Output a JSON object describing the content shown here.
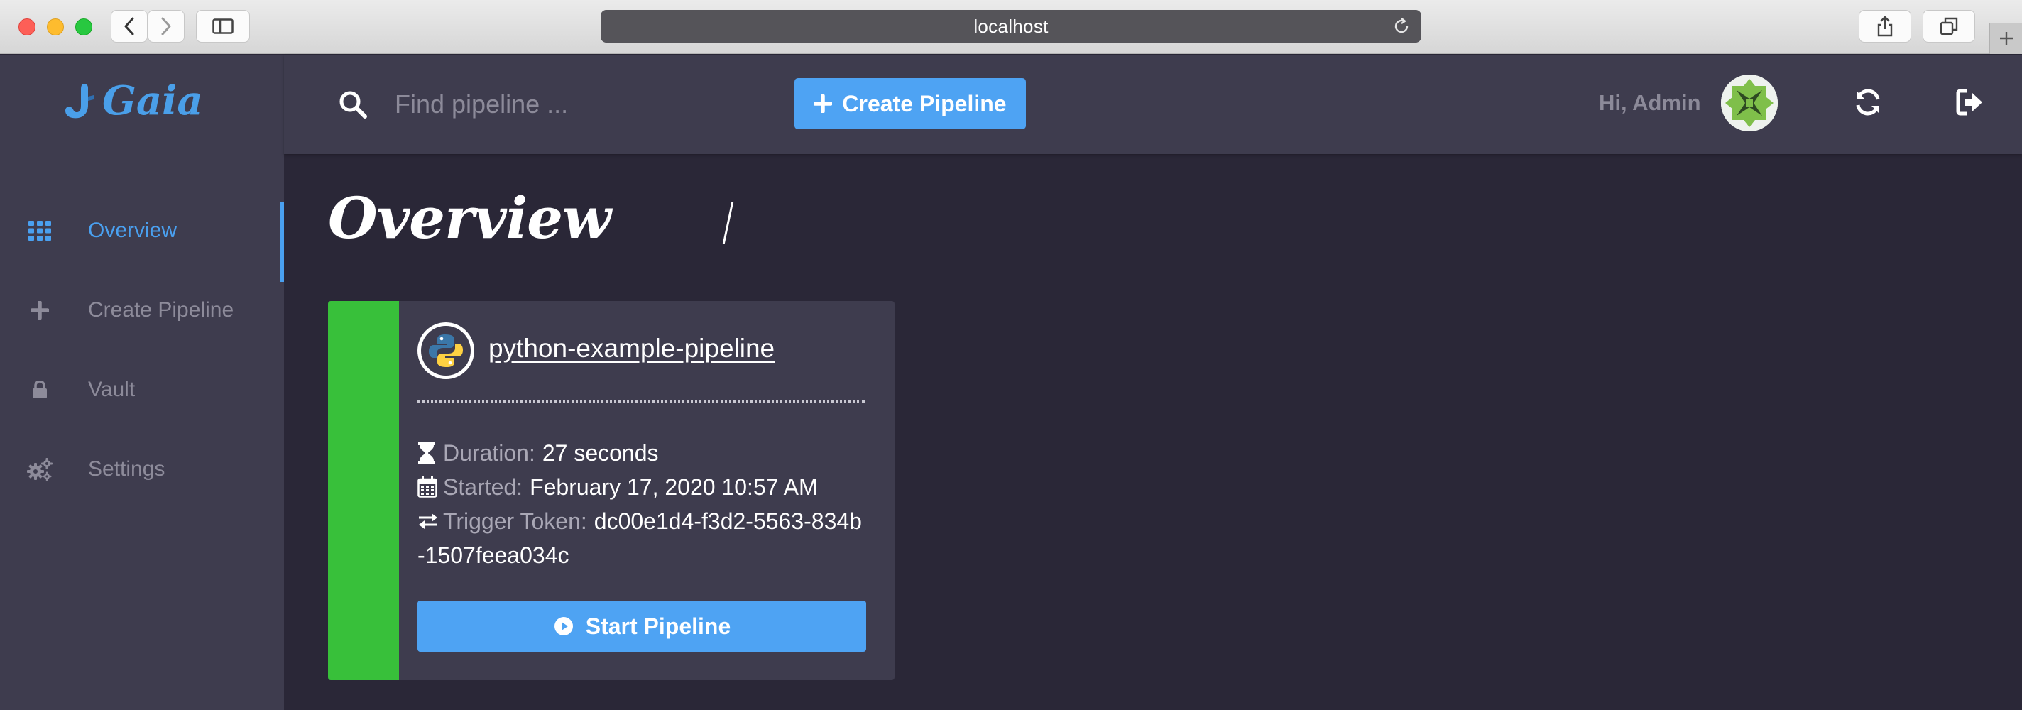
{
  "browser": {
    "url": "localhost"
  },
  "app": {
    "logo_text": "Gaia",
    "nav": [
      {
        "label": "Overview",
        "icon": "grid-icon",
        "active": true
      },
      {
        "label": "Create Pipeline",
        "icon": "plus-icon",
        "active": false
      },
      {
        "label": "Vault",
        "icon": "lock-icon",
        "active": false
      },
      {
        "label": "Settings",
        "icon": "cogs-icon",
        "active": false
      }
    ],
    "search": {
      "placeholder": "Find pipeline ..."
    },
    "create_button": "Create Pipeline",
    "greeting": "Hi, Admin",
    "accent_color": "#4ea3f3",
    "success_color": "#38c03a"
  },
  "page": {
    "title": "Overview"
  },
  "pipeline": {
    "name": "python-example-pipeline",
    "language_icon": "python-icon",
    "duration_label": "Duration:",
    "duration_value": "27 seconds",
    "started_label": "Started:",
    "started_value": "February 17, 2020 10:57 AM",
    "token_label": "Trigger Token:",
    "token_value": "dc00e1d4-f3d2-5563-834b-1507feea034c",
    "start_button": "Start Pipeline",
    "status": "success"
  }
}
